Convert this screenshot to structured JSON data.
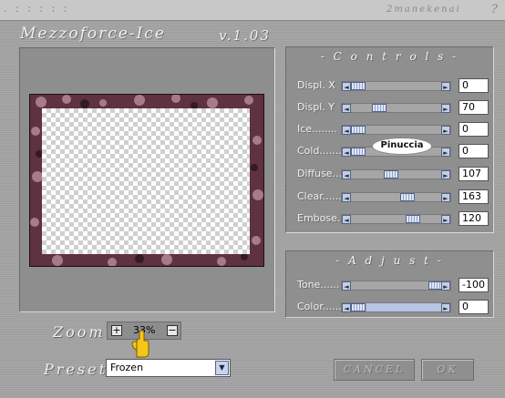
{
  "titlebar": {
    "dots": ". : : : : :",
    "author": "2manekenai",
    "help": "?"
  },
  "app": {
    "title": "Mezzoforce-Ice",
    "version": "v.1.03"
  },
  "controls": {
    "title": "- C o n t r o l s -",
    "params": [
      {
        "label": "Displ. X",
        "value": "0",
        "level": 0.0
      },
      {
        "label": "Displ. Y",
        "value": "70",
        "level": 0.27
      },
      {
        "label": "Ice........",
        "value": "0",
        "level": 0.0
      },
      {
        "label": "Cold.......",
        "value": "0",
        "level": 0.0
      },
      {
        "label": "Diffuse...",
        "value": "107",
        "level": 0.42
      },
      {
        "label": "Clear......",
        "value": "163",
        "level": 0.64
      },
      {
        "label": "Embose...",
        "value": "120",
        "level": 0.71
      }
    ]
  },
  "adjust": {
    "title": "- A d j u s t -",
    "params": [
      {
        "label": "Tone......",
        "value": "-100",
        "level": 1.0
      },
      {
        "label": "Color......",
        "value": "0",
        "level": 0.0
      }
    ]
  },
  "zoom": {
    "label": "Zoom",
    "value": "33%",
    "plus": "+",
    "minus": "−"
  },
  "preset": {
    "label": "Preset",
    "value": "Frozen"
  },
  "buttons": {
    "cancel": "CANCEL",
    "ok": "OK"
  },
  "watermark": "Pinuccia",
  "colors": {
    "frame": "#5e3240",
    "accent": "#c4cfe6"
  }
}
